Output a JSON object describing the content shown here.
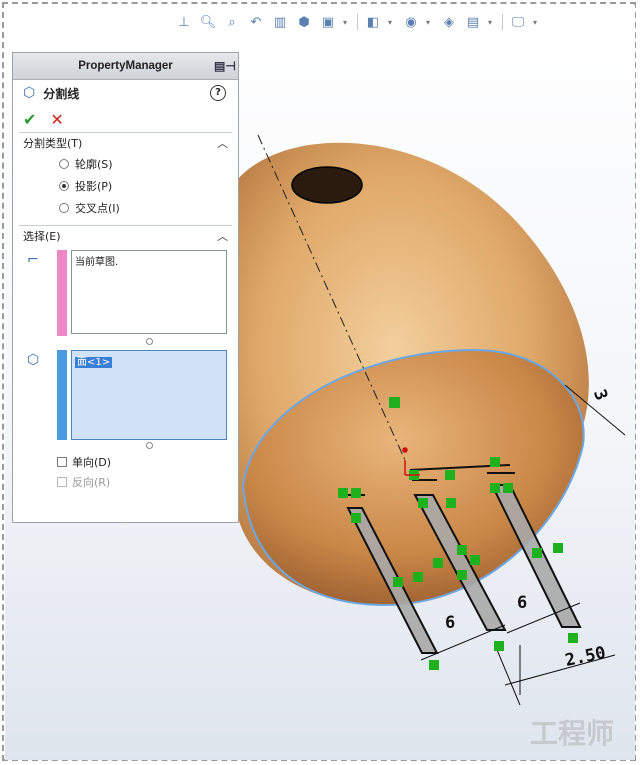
{
  "toolbar": {
    "icons": [
      "view-orientation-icon",
      "zoom-to-fit-icon",
      "zoom-area-icon",
      "previous-view-icon",
      "section-view-icon",
      "view-cube-icon",
      "display-style-icon",
      "hide-show-icon",
      "edit-appearance-icon",
      "apply-scene-icon",
      "view-settings-icon"
    ]
  },
  "property_manager": {
    "title": "PropertyManager",
    "feature_name": "分割线",
    "help": "?",
    "ok": "✔",
    "cancel": "✕",
    "split_type": {
      "heading": "分割类型(T)",
      "options": [
        {
          "label": "轮廓(S)",
          "selected": false
        },
        {
          "label": "投影(P)",
          "selected": true
        },
        {
          "label": "交叉点(I)",
          "selected": false
        }
      ]
    },
    "selections": {
      "heading": "选择(E)",
      "sketch_list_text": "当前草图.",
      "faces_list_item": "面<1>",
      "single_direction": "单向(D)",
      "reverse_direction": "反向(R)"
    },
    "colors": {
      "sketch_bar": "#ef86c5",
      "faces_bar": "#4a9ae2"
    }
  },
  "graphics": {
    "dimensions": [
      "6",
      "6",
      "3",
      "2.50"
    ]
  },
  "watermark": "工程师"
}
